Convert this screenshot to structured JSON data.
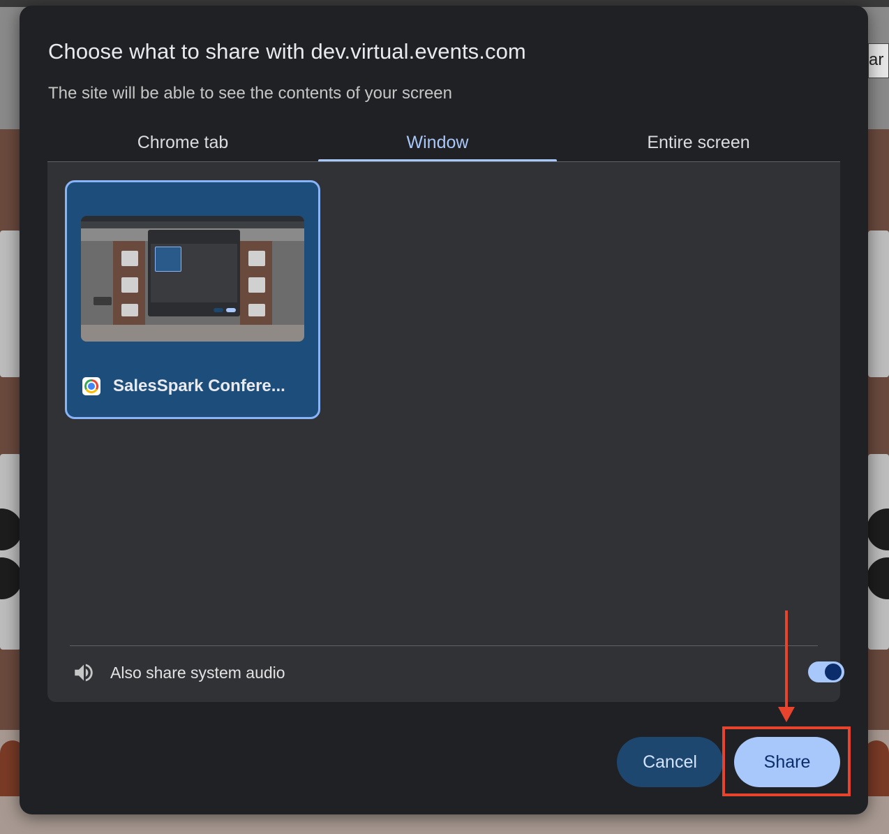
{
  "dialog": {
    "title": "Choose what to share with dev.virtual.events.com",
    "subtitle": "The site will be able to see the contents of your screen"
  },
  "tabs": [
    {
      "label": "Chrome tab",
      "active": false
    },
    {
      "label": "Window",
      "active": true
    },
    {
      "label": "Entire screen",
      "active": false
    }
  ],
  "sources": [
    {
      "title": "SalesSpark Confere...",
      "icon": "chrome-icon",
      "selected": true
    }
  ],
  "audio": {
    "label": "Also share system audio",
    "icon": "speaker-icon",
    "enabled": true
  },
  "buttons": {
    "cancel": "Cancel",
    "share": "Share"
  },
  "background": {
    "side_text": "ar"
  },
  "colors": {
    "accent": "#a8c7fa",
    "dialog_bg": "#202124",
    "panel_bg": "#313236",
    "selected_card": "#1d4d7a",
    "annotation": "#e8432d"
  }
}
